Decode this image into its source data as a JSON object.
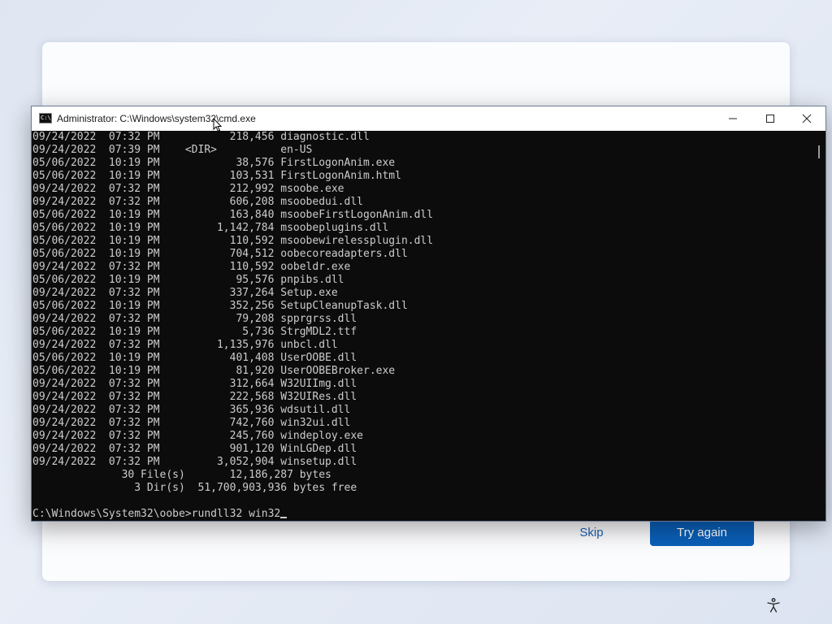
{
  "cmd": {
    "title": "Administrator: C:\\Windows\\system32\\cmd.exe",
    "icon_text": "C:\\",
    "listing": [
      {
        "date": "09/24/2022",
        "time": "07:32 PM",
        "size": "218,456",
        "name": "diagnostic.dll"
      },
      {
        "date": "09/24/2022",
        "time": "07:39 PM",
        "size": "<DIR>",
        "name": "en-US"
      },
      {
        "date": "05/06/2022",
        "time": "10:19 PM",
        "size": "38,576",
        "name": "FirstLogonAnim.exe"
      },
      {
        "date": "05/06/2022",
        "time": "10:19 PM",
        "size": "103,531",
        "name": "FirstLogonAnim.html"
      },
      {
        "date": "09/24/2022",
        "time": "07:32 PM",
        "size": "212,992",
        "name": "msoobe.exe"
      },
      {
        "date": "09/24/2022",
        "time": "07:32 PM",
        "size": "606,208",
        "name": "msoobedui.dll"
      },
      {
        "date": "05/06/2022",
        "time": "10:19 PM",
        "size": "163,840",
        "name": "msoobeFirstLogonAnim.dll"
      },
      {
        "date": "05/06/2022",
        "time": "10:19 PM",
        "size": "1,142,784",
        "name": "msoobeplugins.dll"
      },
      {
        "date": "05/06/2022",
        "time": "10:19 PM",
        "size": "110,592",
        "name": "msoobewirelessplugin.dll"
      },
      {
        "date": "05/06/2022",
        "time": "10:19 PM",
        "size": "704,512",
        "name": "oobecoreadapters.dll"
      },
      {
        "date": "09/24/2022",
        "time": "07:32 PM",
        "size": "110,592",
        "name": "oobeldr.exe"
      },
      {
        "date": "05/06/2022",
        "time": "10:19 PM",
        "size": "95,576",
        "name": "pnpibs.dll"
      },
      {
        "date": "09/24/2022",
        "time": "07:32 PM",
        "size": "337,264",
        "name": "Setup.exe"
      },
      {
        "date": "05/06/2022",
        "time": "10:19 PM",
        "size": "352,256",
        "name": "SetupCleanupTask.dll"
      },
      {
        "date": "09/24/2022",
        "time": "07:32 PM",
        "size": "79,208",
        "name": "spprgrss.dll"
      },
      {
        "date": "05/06/2022",
        "time": "10:19 PM",
        "size": "5,736",
        "name": "StrgMDL2.ttf"
      },
      {
        "date": "09/24/2022",
        "time": "07:32 PM",
        "size": "1,135,976",
        "name": "unbcl.dll"
      },
      {
        "date": "05/06/2022",
        "time": "10:19 PM",
        "size": "401,408",
        "name": "UserOOBE.dll"
      },
      {
        "date": "05/06/2022",
        "time": "10:19 PM",
        "size": "81,920",
        "name": "UserOOBEBroker.exe"
      },
      {
        "date": "09/24/2022",
        "time": "07:32 PM",
        "size": "312,664",
        "name": "W32UIImg.dll"
      },
      {
        "date": "09/24/2022",
        "time": "07:32 PM",
        "size": "222,568",
        "name": "W32UIRes.dll"
      },
      {
        "date": "09/24/2022",
        "time": "07:32 PM",
        "size": "365,936",
        "name": "wdsutil.dll"
      },
      {
        "date": "09/24/2022",
        "time": "07:32 PM",
        "size": "742,760",
        "name": "win32ui.dll"
      },
      {
        "date": "09/24/2022",
        "time": "07:32 PM",
        "size": "245,760",
        "name": "windeploy.exe"
      },
      {
        "date": "09/24/2022",
        "time": "07:32 PM",
        "size": "901,120",
        "name": "WinLGDep.dll"
      },
      {
        "date": "09/24/2022",
        "time": "07:32 PM",
        "size": "3,052,904",
        "name": "winsetup.dll"
      }
    ],
    "summary_files_count": "30 File(s)",
    "summary_files_bytes": "12,186,287 bytes",
    "summary_dirs_count": "3 Dir(s)",
    "summary_dirs_bytes": "51,700,903,936 bytes free",
    "prompt": "C:\\Windows\\System32\\oobe>",
    "command": "rundll32 win32"
  },
  "oobe": {
    "skip_label": "Skip",
    "try_again_label": "Try again"
  },
  "colors": {
    "console_bg": "#0c0c0c",
    "console_fg": "#cccccc",
    "accent": "#0a5fb8"
  }
}
